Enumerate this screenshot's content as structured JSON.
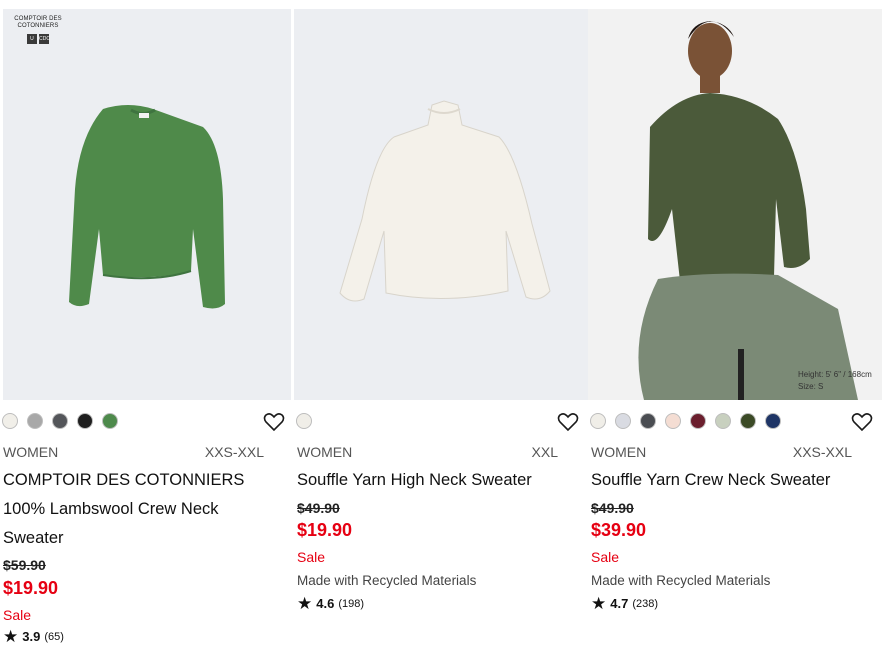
{
  "products": [
    {
      "brand_logo_text": [
        "COMPTOIR DES",
        "COTONNIERS"
      ],
      "brand_squares": [
        "U",
        "CDC"
      ],
      "swatches": [
        "#f1efe9",
        "#a8a8a8",
        "#54565a",
        "#1f1f1f",
        "#4e8a4c"
      ],
      "gender": "WOMEN",
      "size": "XXS-XXL",
      "title_lines": [
        "COMPTOIR DES COTONNIERS",
        "100% Lambswool Crew Neck",
        "Sweater"
      ],
      "price_old": "$59.90",
      "price_new": "$19.90",
      "sale": "Sale",
      "recycled": "",
      "rating": "3.9",
      "reviews": "(65)",
      "image_icon": "green-sweater-image"
    },
    {
      "swatches": [
        "#f0eee8"
      ],
      "gender": "WOMEN",
      "size": "XXL",
      "title": "Souffle Yarn High Neck Sweater",
      "price_old": "$49.90",
      "price_new": "$19.90",
      "sale": "Sale",
      "recycled": "Made with Recycled Materials",
      "rating": "4.6",
      "reviews": "(198)",
      "image_icon": "white-high-neck-sweater-image"
    },
    {
      "swatches": [
        "#f0eee8",
        "#d9dbe2",
        "#4a4d52",
        "#f4ddd3",
        "#6b1f2e",
        "#c8d0bf",
        "#3b4a26",
        "#1f3566"
      ],
      "gender": "WOMEN",
      "size": "XXS-XXL",
      "title": "Souffle Yarn Crew Neck Sweater",
      "price_old": "$49.90",
      "price_new": "$39.90",
      "sale": "Sale",
      "recycled": "Made with Recycled Materials",
      "rating": "4.7",
      "reviews": "(238)",
      "model_info": [
        "Height: 5' 6\" / 168cm",
        "Size: S"
      ],
      "image_icon": "model-wearing-sweater-image"
    }
  ]
}
